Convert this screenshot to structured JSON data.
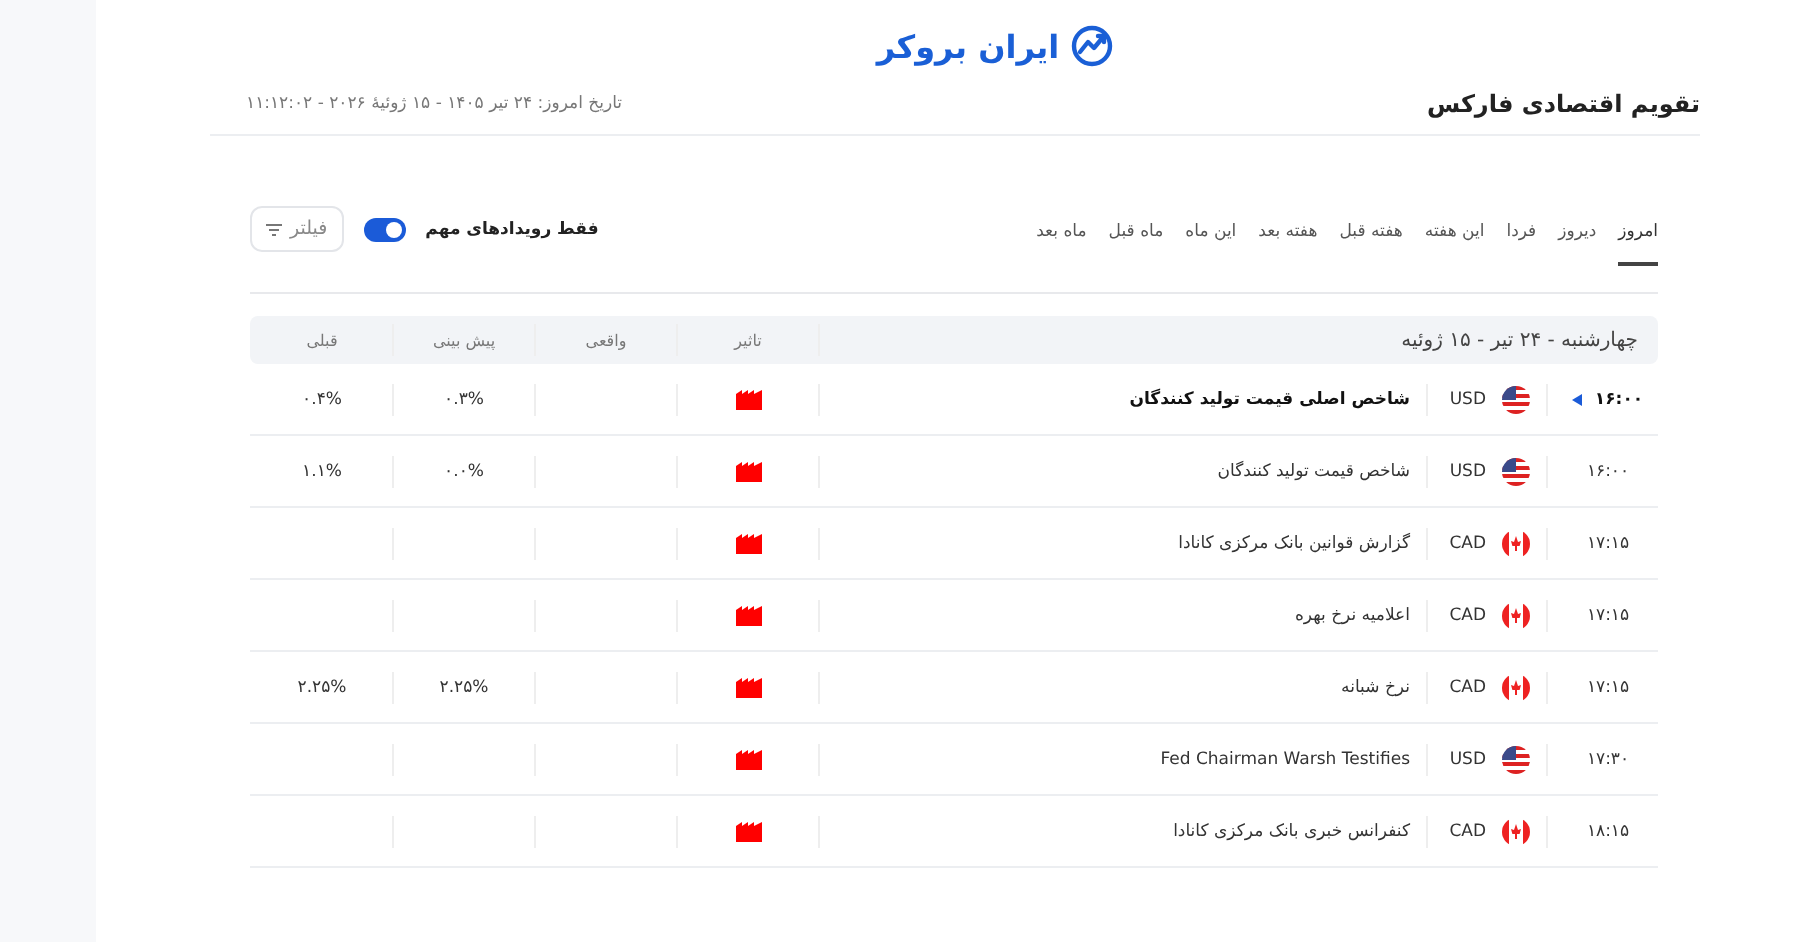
{
  "logo": {
    "text": "ایران بروکر"
  },
  "header": {
    "title": "تقویم اقتصادی فارکس",
    "date": "تاریخ امروز:  ۲۴ تیر ۱۴۰۵ - ۱۵ ژوئیهٔ ۲۰۲۶ - ۱۱:۱۲:۰۲"
  },
  "tabs": [
    {
      "label": "امروز",
      "selected": true
    },
    {
      "label": "دیروز",
      "selected": false
    },
    {
      "label": "فردا",
      "selected": false
    },
    {
      "label": "این هفته",
      "selected": false
    },
    {
      "label": "هفته قبل",
      "selected": false
    },
    {
      "label": "هفته بعد",
      "selected": false
    },
    {
      "label": "این ماه",
      "selected": false
    },
    {
      "label": "ماه قبل",
      "selected": false
    },
    {
      "label": "ماه بعد",
      "selected": false
    }
  ],
  "important_toggle": {
    "label": "فقط رویدادهای مهم",
    "on": true
  },
  "filter_button": {
    "label": "فیلتر"
  },
  "table": {
    "date_heading": "چهارشنبه - ۲۴ تیر - ۱۵ ژوئیه",
    "columns": [
      "تاثیر",
      "واقعی",
      "پیش بینی",
      "قبلی"
    ],
    "rows": [
      {
        "time": "۱۶:۰۰",
        "current": true,
        "flag": {
          "kind": "us"
        },
        "currency": "USD",
        "event": "شاخص اصلی قیمت تولید کنندگان",
        "forecast": "۰.۳%",
        "previous": "۰.۴%"
      },
      {
        "time": "۱۶:۰۰",
        "current": false,
        "flag": {
          "kind": "us"
        },
        "currency": "USD",
        "event": "شاخص قیمت تولید کنندگان",
        "forecast": "۰.۰%",
        "previous": "۱.۱%"
      },
      {
        "time": "۱۷:۱۵",
        "current": false,
        "flag": {
          "kind": "ca"
        },
        "currency": "CAD",
        "event": "گزارش قوانین بانک مرکزی کانادا"
      },
      {
        "time": "۱۷:۱۵",
        "current": false,
        "flag": {
          "kind": "ca"
        },
        "currency": "CAD",
        "event": "اعلامیه نرخ بهره"
      },
      {
        "time": "۱۷:۱۵",
        "current": false,
        "flag": {
          "kind": "ca"
        },
        "currency": "CAD",
        "event": "نرخ شبانه",
        "forecast": "۲.۲۵%",
        "previous": "۲.۲۵%"
      },
      {
        "time": "۱۷:۳۰",
        "current": false,
        "flag": {
          "kind": "us"
        },
        "currency": "USD",
        "event": "Fed Chairman Warsh Testifies"
      },
      {
        "time": "۱۸:۱۵",
        "current": false,
        "flag": {
          "kind": "ca"
        },
        "currency": "CAD",
        "event": "کنفرانس خبری بانک مرکزی کانادا"
      }
    ]
  }
}
